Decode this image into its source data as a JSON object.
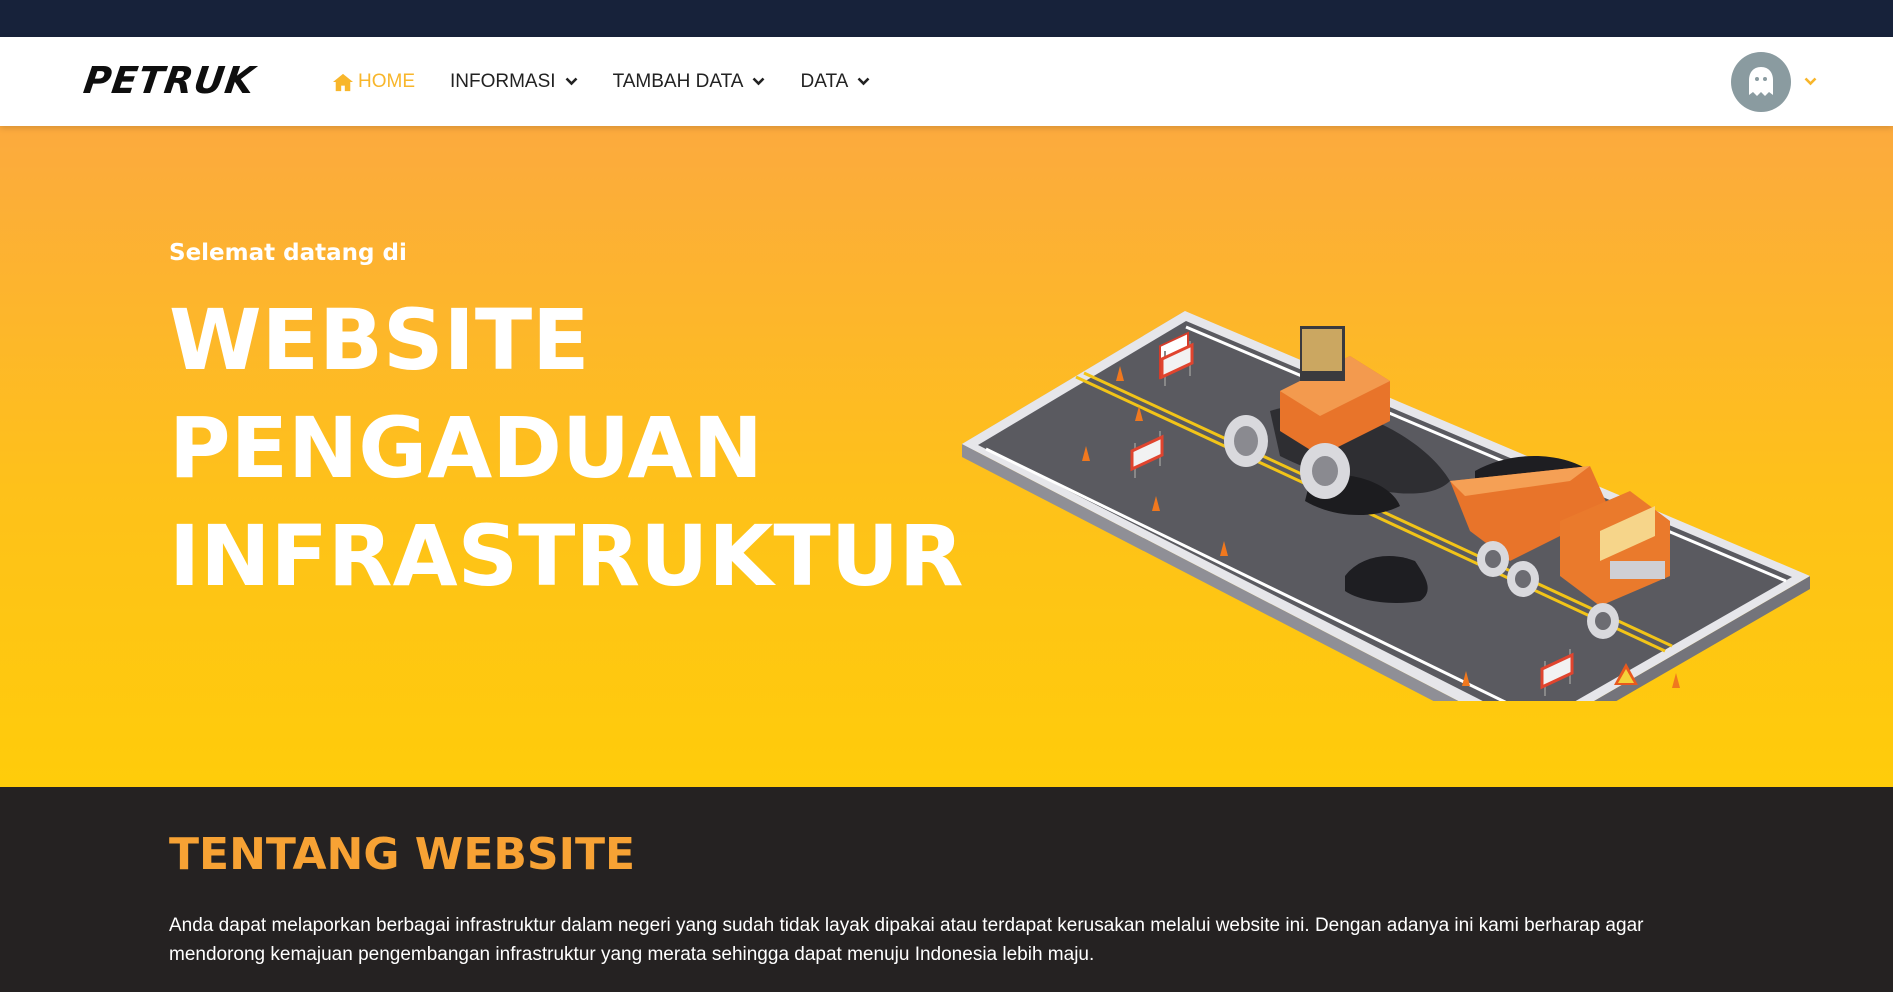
{
  "brand": {
    "logo_text": "PETRUK"
  },
  "nav": {
    "items": [
      {
        "label": "HOME",
        "icon": "home-icon",
        "active": true
      },
      {
        "label": "INFORMASI",
        "icon": "chevron-down-icon",
        "active": false
      },
      {
        "label": "TAMBAH DATA",
        "icon": "chevron-down-icon",
        "active": false
      },
      {
        "label": "DATA",
        "icon": "chevron-down-icon",
        "active": false
      }
    ],
    "user": {
      "avatar_icon": "ghost-icon",
      "menu_icon": "chevron-down-icon"
    }
  },
  "hero": {
    "subtitle": "Selemat datang di",
    "title_lines": [
      "WEBSITE",
      "PENGADUAN",
      "INFRASTRUKTUR"
    ]
  },
  "about": {
    "title": "TENTANG WEBSITE",
    "text": "Anda dapat melaporkan berbagai infrastruktur dalam negeri yang sudah tidak layak dipakai atau terdapat kerusakan melalui website ini. Dengan adanya ini kami berharap agar mendorong kemajuan pengembangan infrastruktur yang merata sehingga dapat menuju Indonesia lebih maju."
  },
  "colors": {
    "top_strip": "#17223a",
    "accent": "#f8b62b",
    "hero_top": "#fcaa3e",
    "hero_bottom": "#ffcc0a",
    "about_bg": "#252222",
    "about_title": "#f7a234"
  }
}
